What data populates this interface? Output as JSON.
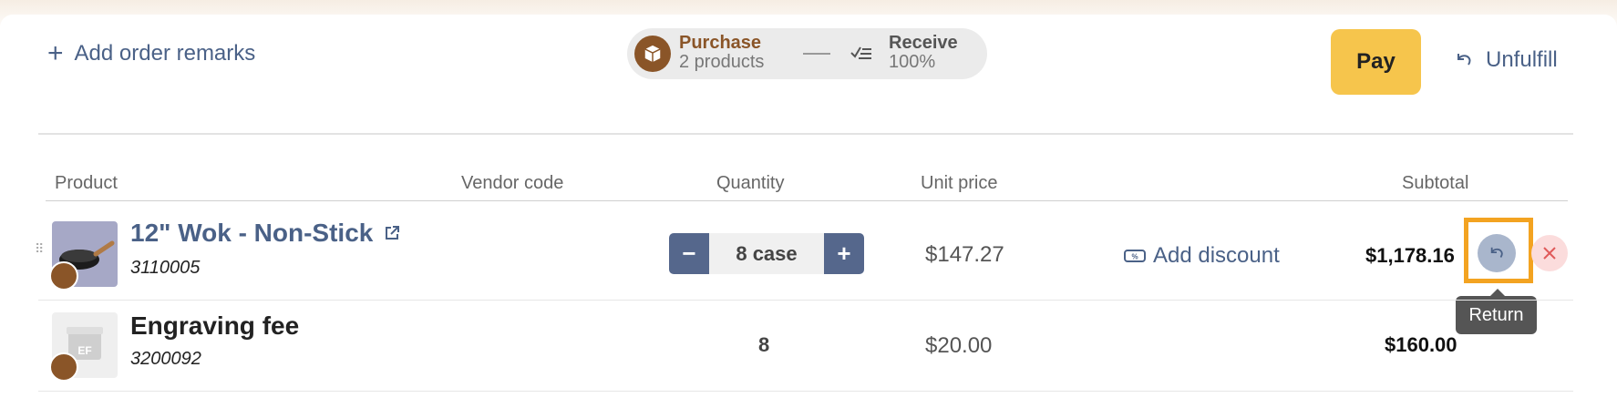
{
  "toolbar": {
    "add_remarks": "Add order remarks",
    "pay": "Pay",
    "unfulfill": "Unfulfill"
  },
  "status": {
    "purchase_title": "Purchase",
    "purchase_sub": "2 products",
    "receive_title": "Receive",
    "receive_sub": "100%"
  },
  "table": {
    "headers": [
      "Product",
      "Vendor code",
      "Quantity",
      "Unit price",
      "Subtotal"
    ],
    "rows": [
      {
        "name": "12\" Wok - Non-Stick",
        "sku": "3110005",
        "quantity": "8 case",
        "unit_price": "$147.27",
        "discount_label": "Add discount",
        "subtotal": "$1,178.16"
      },
      {
        "name": "Engraving fee",
        "sku": "3200092",
        "thumb_text": "EF",
        "quantity": "8",
        "unit_price": "$20.00",
        "subtotal": "$160.00"
      }
    ]
  },
  "tooltip": "Return",
  "colors": {
    "accent": "#4a6187",
    "brand_brown": "#8a5528",
    "pay_yellow": "#f6c54c",
    "highlight_orange": "#f3a321"
  }
}
